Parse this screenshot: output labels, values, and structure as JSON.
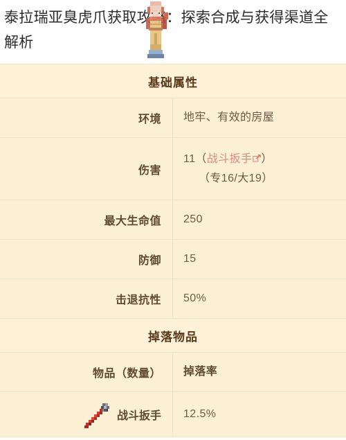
{
  "article": {
    "title": "泰拉瑞亚臭虎爪获取攻略：探索合成与获得渠道全解析",
    "sprite_icon": "terraria-npc-sprite"
  },
  "infobox": {
    "sections": [
      {
        "heading": "基础属性",
        "rows": [
          {
            "label": "环境",
            "value": "地牢、有效的房屋"
          },
          {
            "label": "伤害",
            "value_prefix": "11（",
            "value_link": "战斗扳手",
            "value_link_icon": "external-link-icon",
            "value_suffix": "）",
            "value_line2": "（专16/大19）"
          },
          {
            "label": "最大生命值",
            "value": "250"
          },
          {
            "label": "防御",
            "value": "15"
          },
          {
            "label": "击退抗性",
            "value": "50%"
          }
        ]
      },
      {
        "heading": "掉落物品",
        "column_headers": {
          "item": "物品（数量）",
          "rate": "掉落率"
        },
        "drops": [
          {
            "icon": "battle-wrench-icon",
            "name": "战斗扳手",
            "rate": "12.5%"
          }
        ]
      }
    ]
  },
  "colors": {
    "page_background": "#ffffff",
    "table_background": "#fcf0d4",
    "heading_text": "#5a3a1c",
    "label_text": "#5e4a33",
    "value_text": "#6b5a45",
    "link_accent": "#d98a86",
    "divider": "#f0e3c5"
  }
}
